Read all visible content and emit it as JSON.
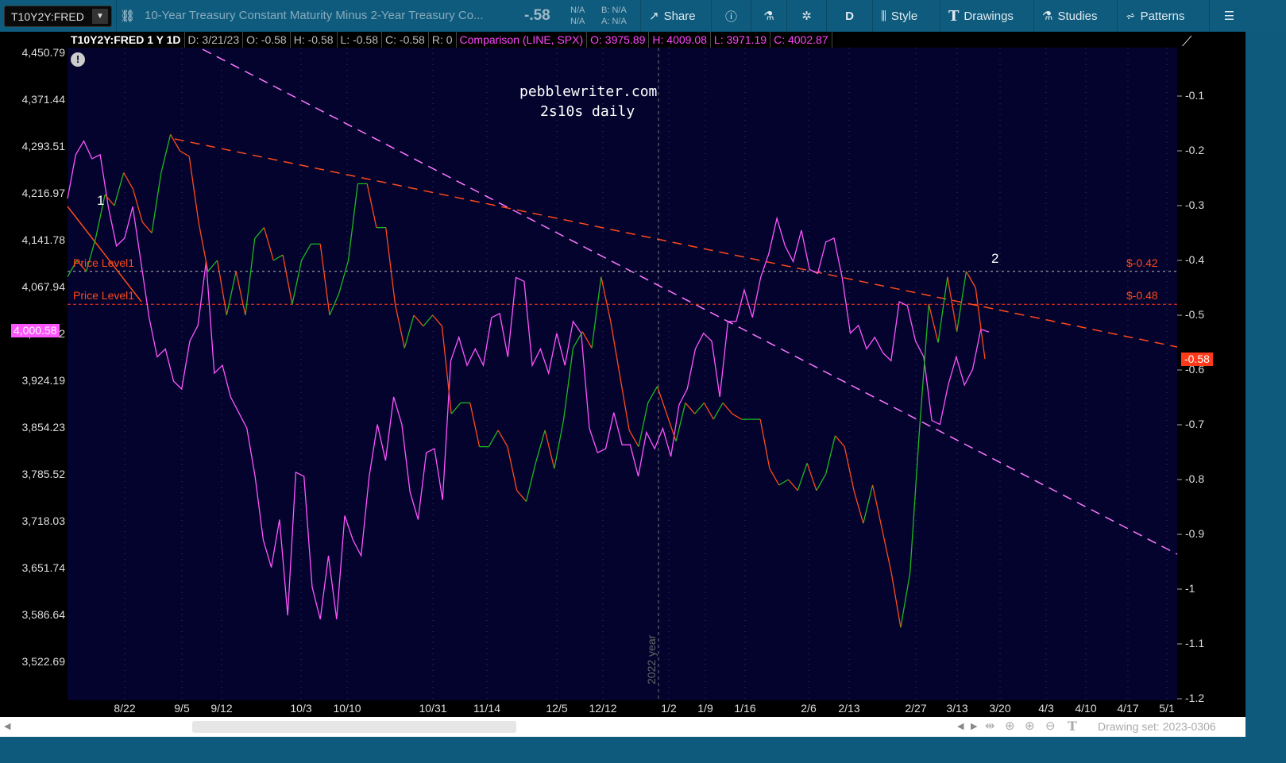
{
  "toolbar": {
    "symbol": "T10Y2Y:FRED",
    "description": "10-Year Treasury Constant Maturity Minus 2-Year Treasury Co...",
    "last": "-.58",
    "na1": "N/A",
    "na2": "N/A",
    "bid": "B: N/A",
    "ask": "A: N/A",
    "share": "Share",
    "aggregation": "D",
    "style": "Style",
    "drawings": "Drawings",
    "studies": "Studies",
    "patterns": "Patterns"
  },
  "header": {
    "title": "T10Y2Y:FRED 1 Y 1D",
    "date": "D: 3/21/23",
    "open": "O: -0.58",
    "high": "H: -0.58",
    "low": "L: -0.58",
    "close": "C: -0.58",
    "range": "R: 0",
    "comparison": "Comparison (LINE, SPX)",
    "c_open": "O: 3975.89",
    "c_high": "H: 4009.08",
    "c_low": "L: 3971.19",
    "c_close": "C: 4002.87"
  },
  "watermark": {
    "line1": "pebblewriter.com",
    "line2": "2s10s daily"
  },
  "annotations": {
    "label1": "1",
    "label2": "2",
    "price_level1": "Price Level1",
    "price_level2": "Price Level1",
    "level1_tag": "$-0.42",
    "level2_tag": "$-0.48",
    "level1_value": -0.42,
    "level2_value": -0.48,
    "year_marker": "2022 year"
  },
  "left_axis": [
    "4,450.79",
    "4,371.44",
    "4,293.51",
    "4,216.97",
    "4,141.78",
    "4,067.94",
    "3,995.42",
    "3,924.19",
    "3,854.23",
    "3,785.52",
    "3,718.03",
    "3,651.74",
    "3,586.64",
    "3,522.69"
  ],
  "left_current": "4,000.58",
  "right_axis": [
    "-0.1",
    "-0.2",
    "-0.3",
    "-0.4",
    "-0.5",
    "-0.6",
    "-0.7",
    "-0.8",
    "-0.9",
    "-1",
    "-1.1",
    "-1.2"
  ],
  "right_current": "-0.58",
  "dates": [
    "8/22",
    "9/5",
    "9/12",
    "10/3",
    "10/10",
    "10/31",
    "11/14",
    "12/5",
    "12/12",
    "1/2",
    "1/9",
    "1/16",
    "2/6",
    "2/13",
    "2/27",
    "3/13",
    "3/20",
    "4/3",
    "4/10",
    "4/17",
    "5/1"
  ],
  "bottom": {
    "drawing_set": "Drawing set: 2023-0306"
  },
  "colors": {
    "up": "#1fb81f",
    "down": "#ff4a1a",
    "spx": "#ff55ff",
    "plot_bg": "#03032e",
    "toolbar": "#0f5b7d"
  },
  "series_2s10s": [
    -0.43,
    -0.4,
    -0.42,
    -0.36,
    -0.28,
    -0.3,
    -0.24,
    -0.27,
    -0.33,
    -0.35,
    -0.24,
    -0.17,
    -0.2,
    -0.21,
    -0.33,
    -0.42,
    -0.4,
    -0.5,
    -0.42,
    -0.5,
    -0.36,
    -0.34,
    -0.4,
    -0.39,
    -0.48,
    -0.4,
    -0.37,
    -0.37,
    -0.5,
    -0.46,
    -0.4,
    -0.26,
    -0.26,
    -0.34,
    -0.34,
    -0.48,
    -0.56,
    -0.5,
    -0.52,
    -0.5,
    -0.52,
    -0.68,
    -0.66,
    -0.66,
    -0.74,
    -0.74,
    -0.71,
    -0.74,
    -0.82,
    -0.84,
    -0.77,
    -0.71,
    -0.78,
    -0.69,
    -0.56,
    -0.53,
    -0.56,
    -0.43,
    -0.51,
    -0.61,
    -0.71,
    -0.74,
    -0.66,
    -0.63,
    -0.68,
    -0.73,
    -0.66,
    -0.68,
    -0.66,
    -0.69,
    -0.66,
    -0.68,
    -0.69,
    -0.69,
    -0.69,
    -0.78,
    -0.81,
    -0.8,
    -0.82,
    -0.77,
    -0.82,
    -0.79,
    -0.72,
    -0.74,
    -0.82,
    -0.88,
    -0.81,
    -0.89,
    -0.97,
    -1.07,
    -0.97,
    -0.71,
    -0.48,
    -0.55,
    -0.43,
    -0.53,
    -0.42,
    -0.45,
    -0.58
  ],
  "series_spx": [
    4229,
    4296,
    4317,
    4290,
    4296,
    4217,
    4157,
    4169,
    4217,
    4133,
    4048,
    3988,
    4000,
    3951,
    3939,
    4012,
    4036,
    4133,
    3963,
    3975,
    3927,
    3903,
    3879,
    3806,
    3709,
    3667,
    3740,
    3594,
    3812,
    3806,
    3637,
    3588,
    3685,
    3588,
    3746,
    3709,
    3685,
    3806,
    3885,
    3830,
    3927,
    3885,
    3782,
    3740,
    3842,
    3848,
    3770,
    3982,
    4018,
    3975,
    4000,
    3975,
    4048,
    4054,
    3988,
    4109,
    4103,
    3975,
    4000,
    3963,
    4024,
    3975,
    4042,
    4024,
    3879,
    3842,
    3848,
    3903,
    3854,
    3854,
    3806,
    3873,
    3848,
    3879,
    3836,
    3915,
    3939,
    4000,
    4024,
    4012,
    3927,
    4042,
    4042,
    4090,
    4048,
    4109,
    4145,
    4199,
    4157,
    4133,
    4181,
    4121,
    4115,
    4163,
    4169,
    4109,
    4024,
    4036,
    4000,
    4018,
    3994,
    3982,
    4072,
    4066,
    4012,
    3988,
    3891,
    3885,
    3945,
    3988,
    3945,
    3969,
    4030,
    4026
  ]
}
